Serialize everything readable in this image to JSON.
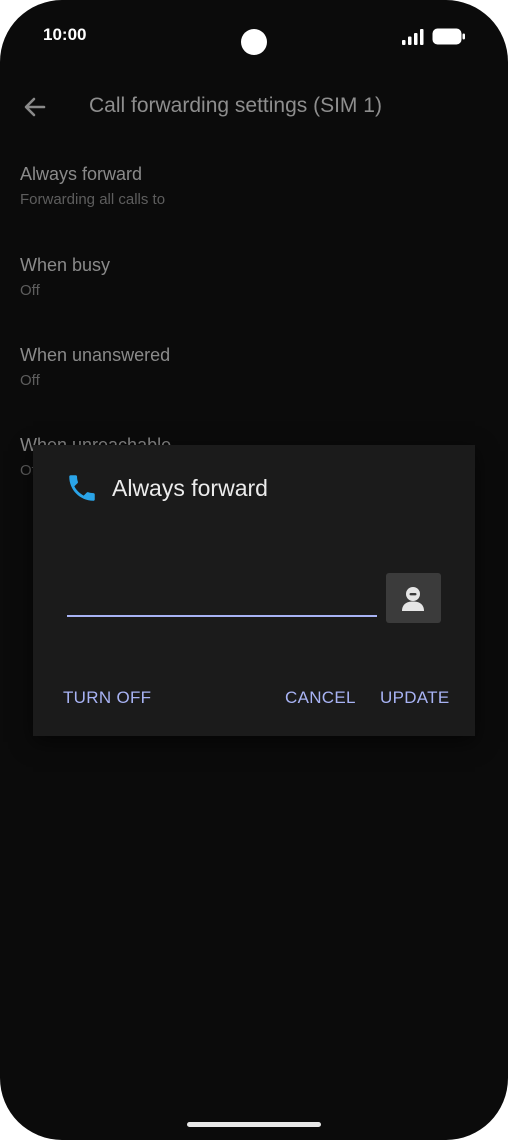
{
  "status_bar": {
    "time": "10:00",
    "icons": [
      "signal-icon",
      "battery-icon"
    ]
  },
  "app_bar": {
    "back_icon": "arrow-back-icon",
    "title": "Call forwarding settings (SIM 1)"
  },
  "settings": {
    "items": [
      {
        "title": "Always forward",
        "subtitle": "Forwarding all calls to"
      },
      {
        "title": "When busy",
        "subtitle": "Off"
      },
      {
        "title": "When unanswered",
        "subtitle": "Off"
      },
      {
        "title": "When unreachable",
        "subtitle": "Off"
      }
    ]
  },
  "dialog": {
    "icon": "phone-icon",
    "title": "Always forward",
    "number_value": "",
    "contact_icon": "contact-picker-icon",
    "buttons": {
      "turn_off": "TURN OFF",
      "cancel": "CANCEL",
      "update": "UPDATE"
    }
  },
  "colors": {
    "background": "#0b0b0b",
    "dialog_background": "#1b1b1b",
    "accent": "#a8b3f4",
    "phone_icon": "#2aa4e8"
  }
}
